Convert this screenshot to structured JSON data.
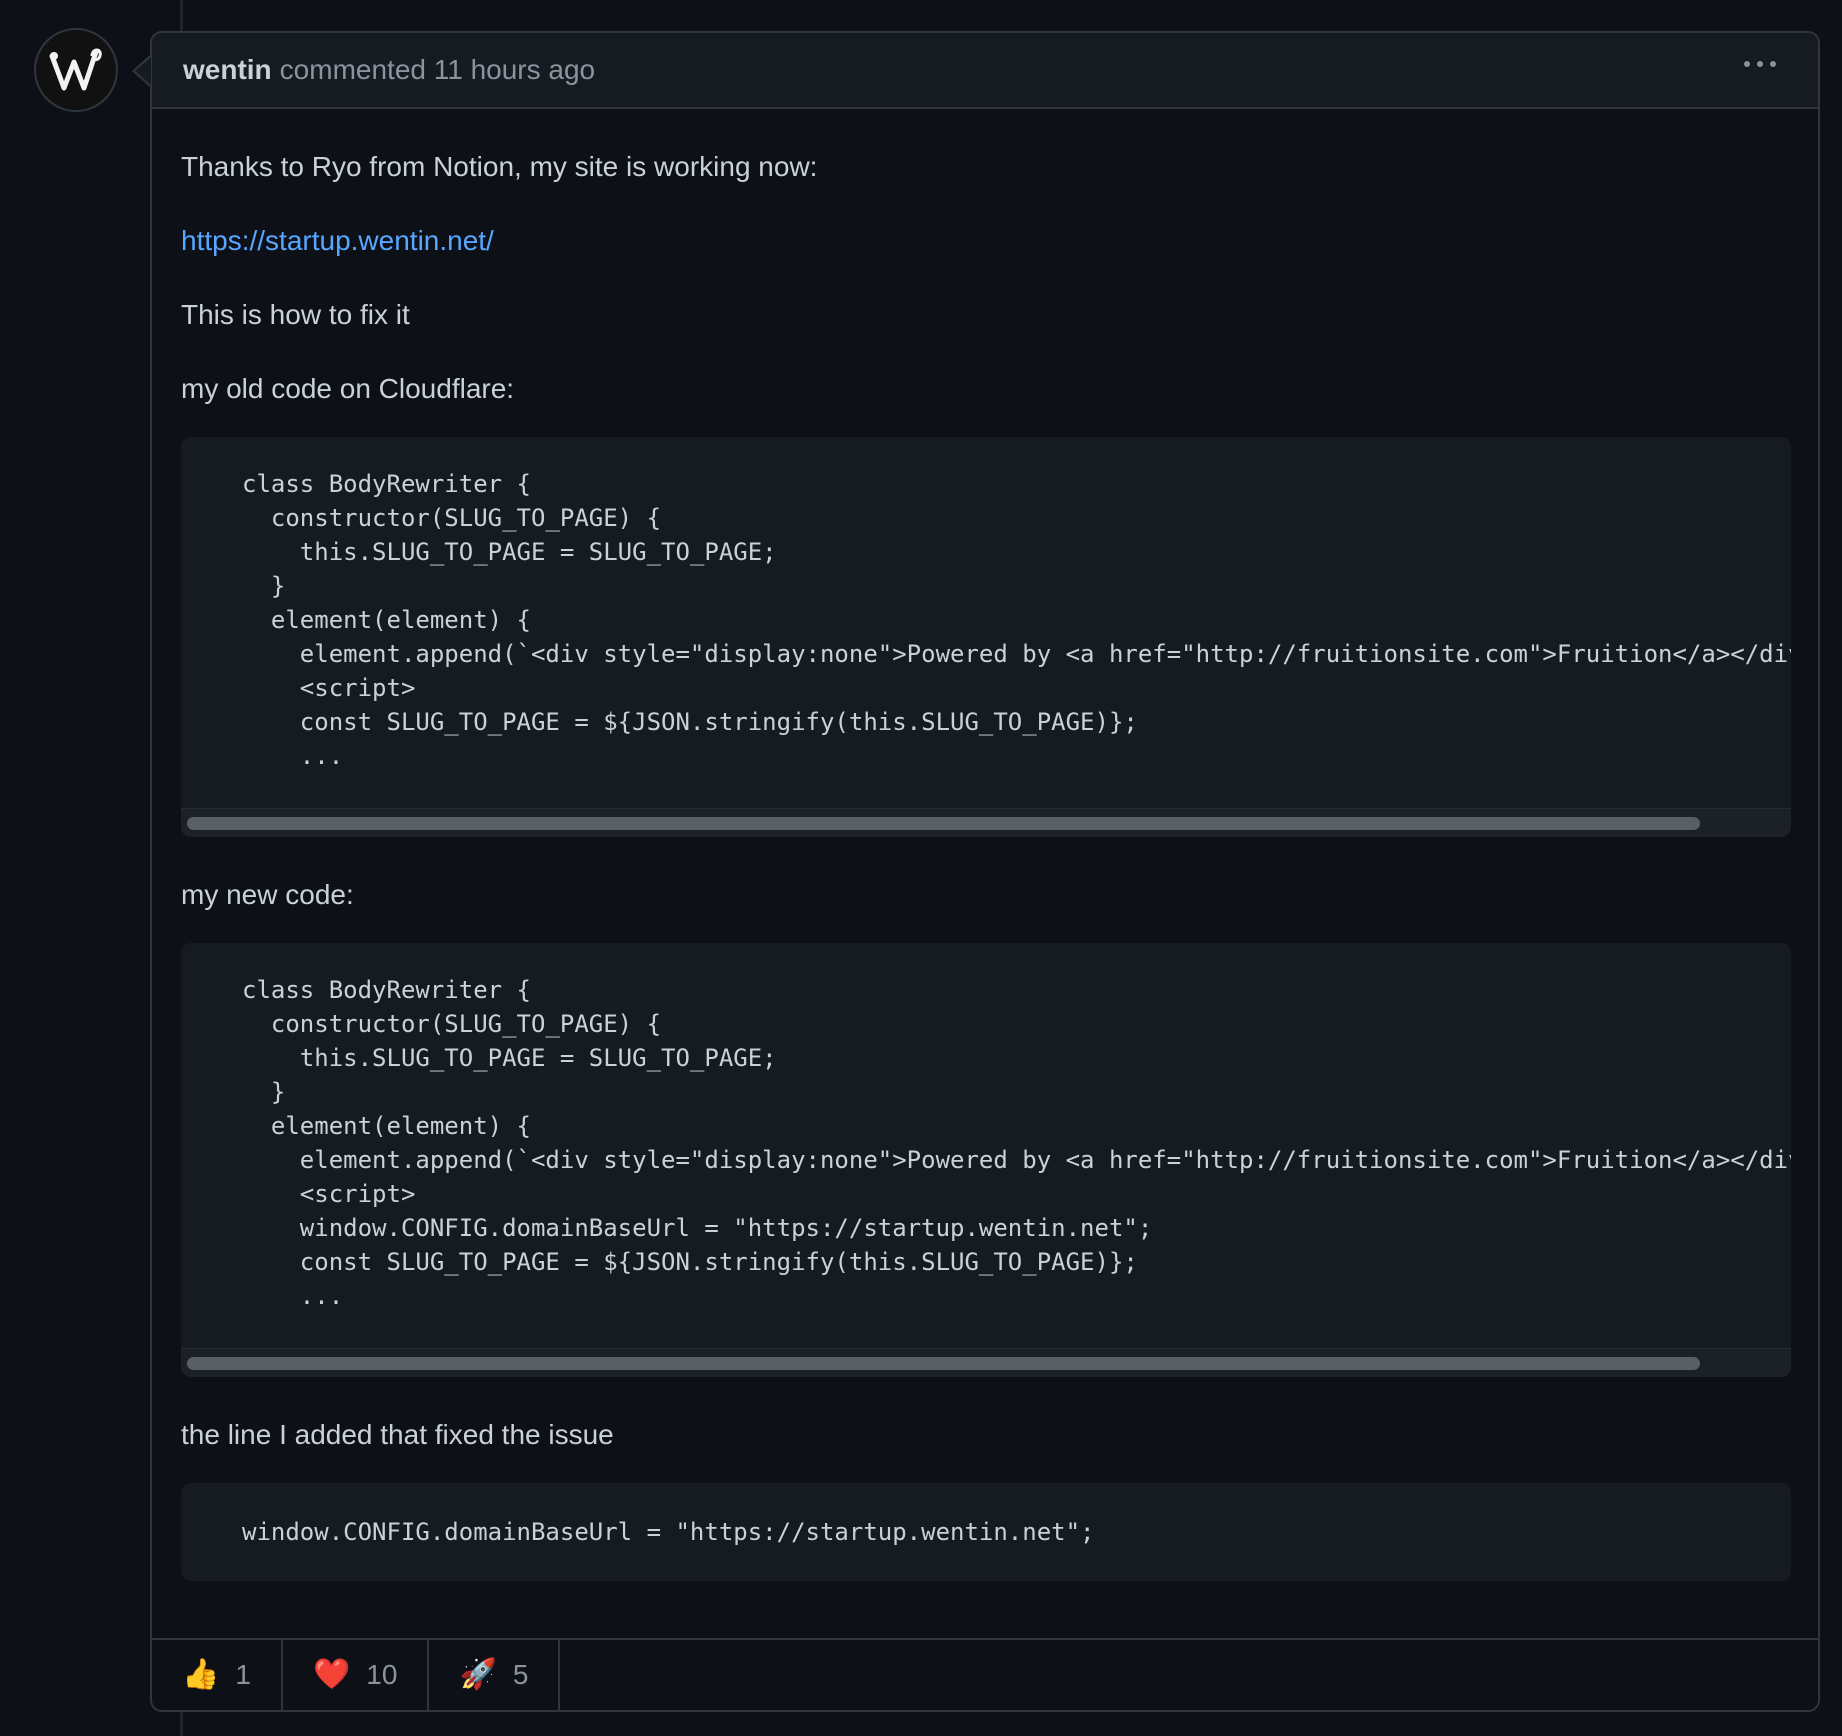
{
  "comment": {
    "author": "wentin",
    "meta": "commented 11 hours ago",
    "avatar_icon": "w-monogram-icon"
  },
  "body": {
    "intro": "Thanks to Ryo from Notion, my site is working now:",
    "link": "https://startup.wentin.net/",
    "fix_heading": "This is how to fix it",
    "old_label": "my old code on Cloudflare:",
    "old_code": "class BodyRewriter {\n  constructor(SLUG_TO_PAGE) {\n    this.SLUG_TO_PAGE = SLUG_TO_PAGE;\n  }\n  element(element) {\n    element.append(`<div style=\"display:none\">Powered by <a href=\"http://fruitionsite.com\">Fruition</a></div>\n    <script>\n    const SLUG_TO_PAGE = ${JSON.stringify(this.SLUG_TO_PAGE)};\n    ...",
    "new_label": "my new code:",
    "new_code": "class BodyRewriter {\n  constructor(SLUG_TO_PAGE) {\n    this.SLUG_TO_PAGE = SLUG_TO_PAGE;\n  }\n  element(element) {\n    element.append(`<div style=\"display:none\">Powered by <a href=\"http://fruitionsite.com\">Fruition</a></div>\n    <script>\n    window.CONFIG.domainBaseUrl = \"https://startup.wentin.net\";\n    const SLUG_TO_PAGE = ${JSON.stringify(this.SLUG_TO_PAGE)};\n    ...",
    "added_label": "the line I added that fixed the issue",
    "added_code": "window.CONFIG.domainBaseUrl = \"https://startup.wentin.net\";"
  },
  "reactions": [
    {
      "emoji": "👍",
      "count": "1",
      "icon": "thumbs-up-icon"
    },
    {
      "emoji": "❤️",
      "count": "10",
      "icon": "heart-icon"
    },
    {
      "emoji": "🚀",
      "count": "5",
      "icon": "rocket-icon"
    }
  ],
  "colors": {
    "background": "#0d1117",
    "header": "#161b22",
    "border": "#30363d",
    "link": "#58a6ff",
    "text": "#c9d1d9",
    "muted": "#8b949e"
  }
}
